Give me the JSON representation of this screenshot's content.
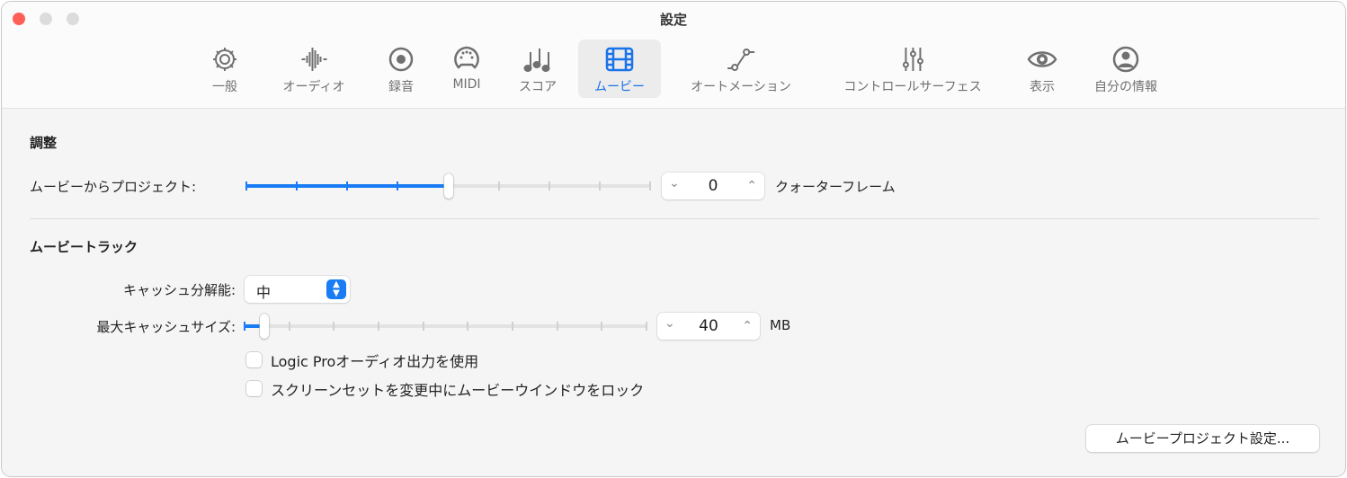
{
  "window": {
    "title": "設定"
  },
  "tabs": [
    {
      "label": "一般",
      "icon": "gear-icon"
    },
    {
      "label": "オーディオ",
      "icon": "waveform-icon"
    },
    {
      "label": "録音",
      "icon": "record-icon"
    },
    {
      "label": "MIDI",
      "icon": "midi-port-icon"
    },
    {
      "label": "スコア",
      "icon": "notes-icon"
    },
    {
      "label": "ムービー",
      "icon": "film-icon",
      "selected": true
    },
    {
      "label": "オートメーション",
      "icon": "automation-icon"
    },
    {
      "label": "コントロールサーフェス",
      "icon": "sliders-icon"
    },
    {
      "label": "表示",
      "icon": "eye-icon"
    },
    {
      "label": "自分の情報",
      "icon": "person-icon"
    }
  ],
  "adjust": {
    "heading": "調整",
    "label": "ムービーからプロジェクト:",
    "slider_fraction": 0.5,
    "value": "0",
    "unit": "クォーターフレーム"
  },
  "track": {
    "heading": "ムービートラック",
    "cache_res_label": "キャッシュ分解能:",
    "cache_res_value": "中",
    "cache_size_label": "最大キャッシュサイズ:",
    "cache_size_fraction": 0.05,
    "cache_size_value": "40",
    "cache_size_unit": "MB",
    "checkbox1": "Logic Proオーディオ出力を使用",
    "checkbox2": "スクリーンセットを変更中にムービーウインドウをロック"
  },
  "button": "ムービープロジェクト設定..."
}
